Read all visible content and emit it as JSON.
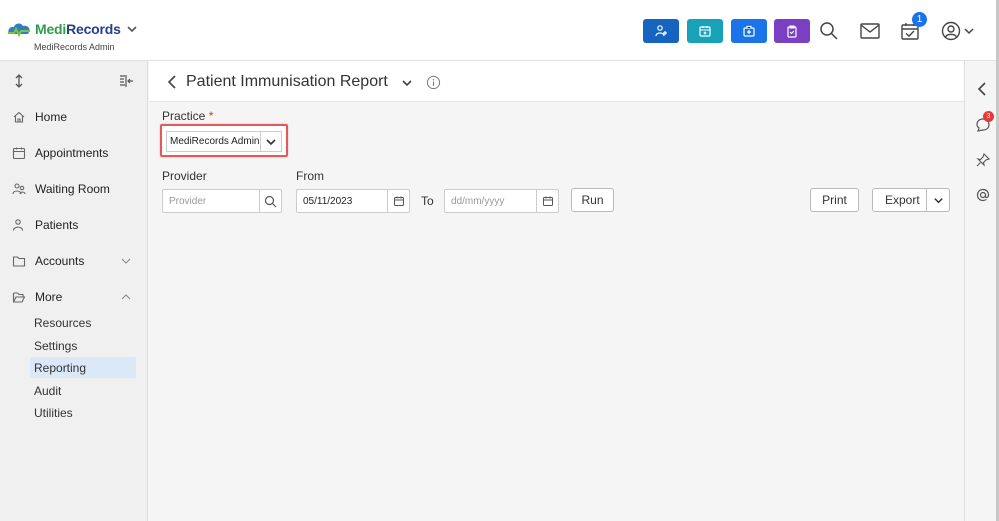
{
  "brand": {
    "name": "MediRecords",
    "subtitle": "MediRecords Admin"
  },
  "topbar": {
    "colors": {
      "add_patient": "#1565c0",
      "calendar": "#17a2b8",
      "medkit": "#1a73e8",
      "clipboard": "#7b3fc4"
    },
    "tasks_badge": "1"
  },
  "sidebar": {
    "items": [
      {
        "label": "Home"
      },
      {
        "label": "Appointments"
      },
      {
        "label": "Waiting Room"
      },
      {
        "label": "Patients"
      },
      {
        "label": "Accounts"
      },
      {
        "label": "More"
      }
    ],
    "subitems": [
      {
        "label": "Resources"
      },
      {
        "label": "Settings"
      },
      {
        "label": "Reporting"
      },
      {
        "label": "Audit"
      },
      {
        "label": "Utilities"
      }
    ]
  },
  "page": {
    "title": "Patient Immunisation Report"
  },
  "form": {
    "practice_label": "Practice",
    "required_mark": "*",
    "practice_value": "MediRecords Admin",
    "provider_label": "Provider",
    "provider_placeholder": "Provider",
    "from_label": "From",
    "from_value": "05/11/2023",
    "to_label": "To",
    "to_placeholder": "dd/mm/yyyy",
    "run_label": "Run",
    "print_label": "Print",
    "export_label": "Export"
  },
  "rail": {
    "notif_badge": "3"
  }
}
